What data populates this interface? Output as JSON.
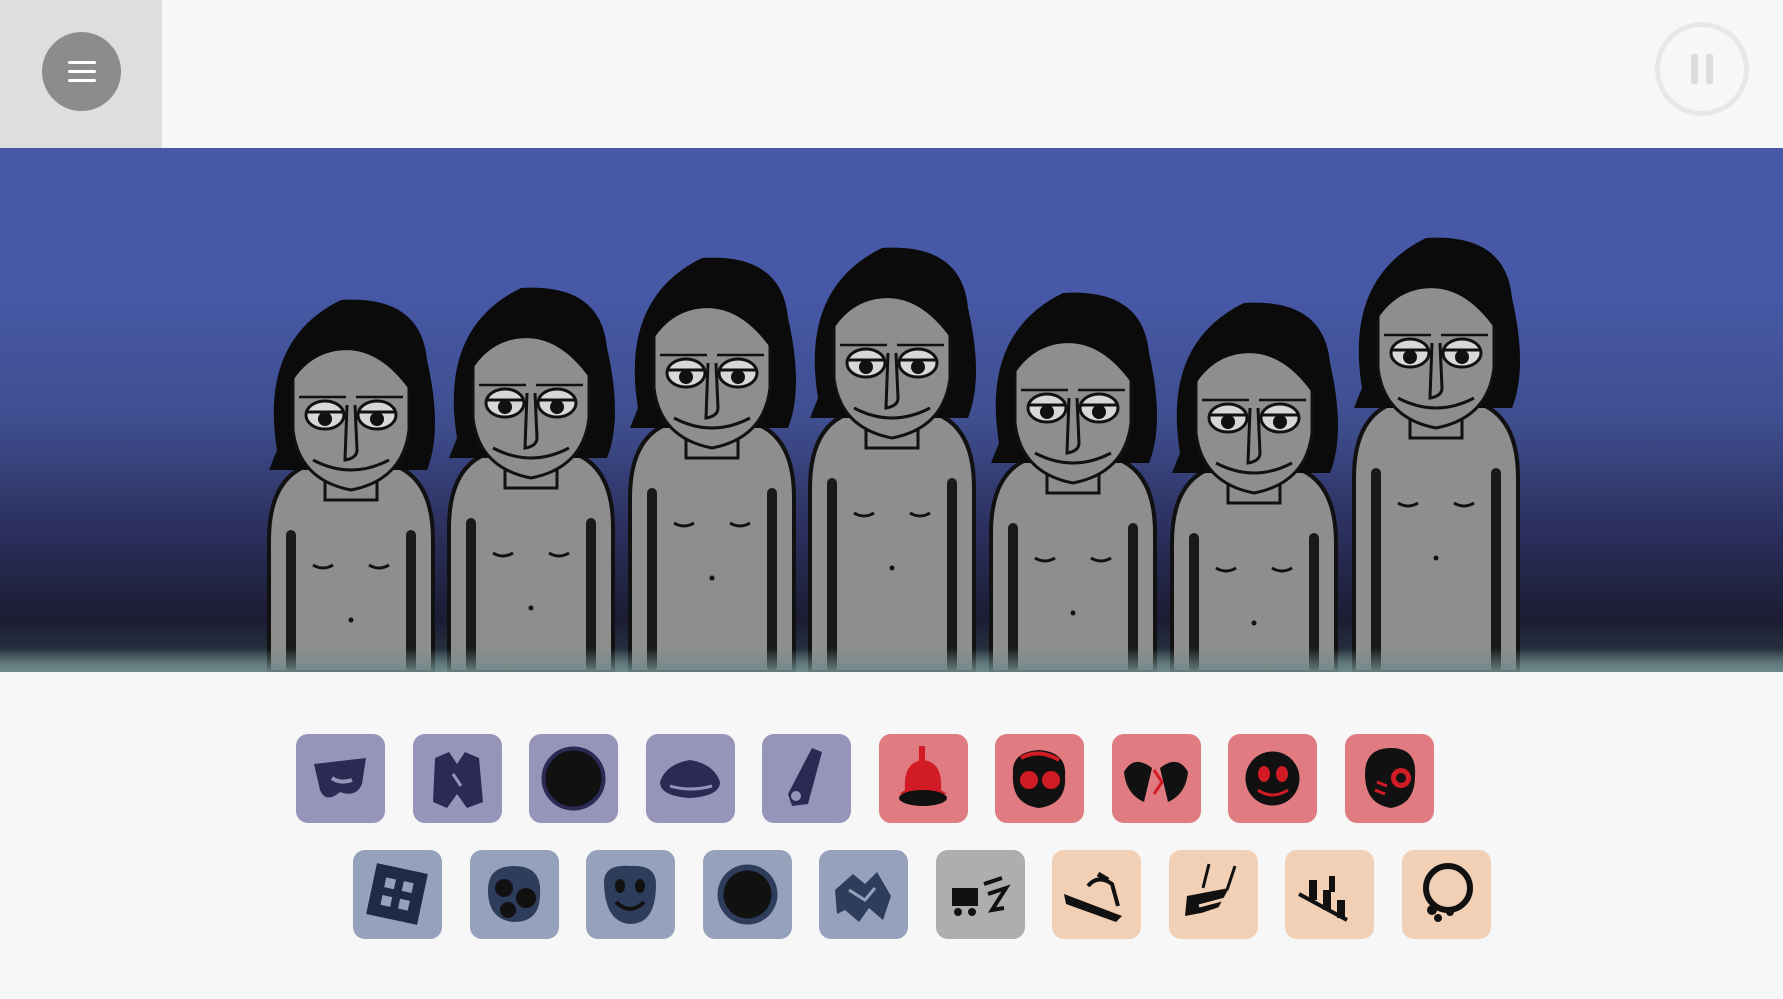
{
  "app": {
    "menu_icon": "hamburger-icon",
    "pause_icon": "pause-icon"
  },
  "colors": {
    "stage_top": "#4658a6",
    "stage_bottom": "#1b1c33",
    "character_skin": "#8e8e8e",
    "character_hair": "#0b0b0b",
    "beats_tile": "#9695b9",
    "effects_tile": "#e07b82",
    "melodies_tile": "#96a2bc",
    "chorus_tile": "#aeaeae",
    "voices_tile": "#f2d0b5"
  },
  "stage": {
    "performer_count": 7,
    "performers": [
      {
        "slot": 1,
        "state": "idle"
      },
      {
        "slot": 2,
        "state": "idle"
      },
      {
        "slot": 3,
        "state": "idle"
      },
      {
        "slot": 4,
        "state": "idle"
      },
      {
        "slot": 5,
        "state": "idle"
      },
      {
        "slot": 6,
        "state": "idle"
      },
      {
        "slot": 7,
        "state": "idle"
      }
    ]
  },
  "sound_tray": {
    "row1": [
      {
        "icon": "cap-icon",
        "category": "beats"
      },
      {
        "icon": "vest-icon",
        "category": "beats"
      },
      {
        "icon": "black-disc-icon",
        "category": "beats"
      },
      {
        "icon": "bowler-hat-icon",
        "category": "beats"
      },
      {
        "icon": "whistle-icon",
        "category": "beats"
      },
      {
        "icon": "bell-hat-icon",
        "category": "effects"
      },
      {
        "icon": "goggles-mask-icon",
        "category": "effects"
      },
      {
        "icon": "broken-heart-icon",
        "category": "effects"
      },
      {
        "icon": "round-face-icon",
        "category": "effects"
      },
      {
        "icon": "headphones-skull-icon",
        "category": "effects"
      }
    ],
    "row2": [
      {
        "icon": "tile-grid-icon",
        "category": "melodies"
      },
      {
        "icon": "three-dots-mask-icon",
        "category": "melodies"
      },
      {
        "icon": "smiley-mask-icon",
        "category": "melodies"
      },
      {
        "icon": "vinyl-disc-icon",
        "category": "melodies"
      },
      {
        "icon": "torn-cloth-icon",
        "category": "melodies"
      },
      {
        "icon": "truck-scribble-icon",
        "category": "chorus"
      },
      {
        "icon": "sash-icon",
        "category": "voices"
      },
      {
        "icon": "cross-straps-icon",
        "category": "voices"
      },
      {
        "icon": "piano-keys-icon",
        "category": "voices"
      },
      {
        "icon": "necklace-icon",
        "category": "voices"
      }
    ]
  }
}
